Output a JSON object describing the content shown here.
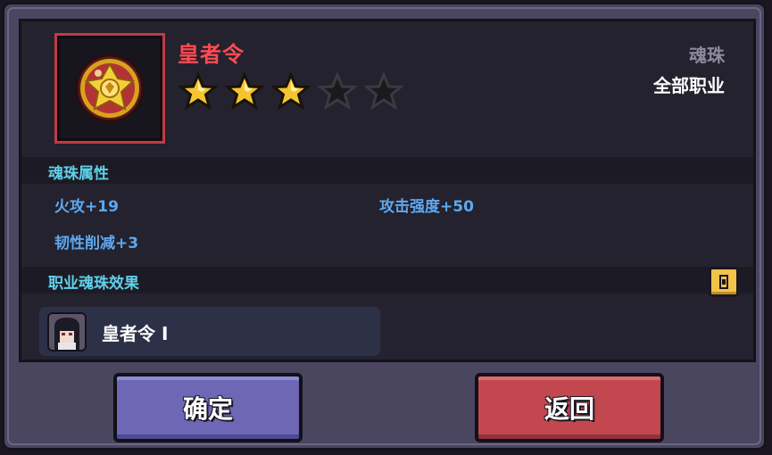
{
  "item": {
    "name": "皇者令",
    "rating": 3,
    "max_rating": 5,
    "type": "魂珠",
    "class": "全部职业"
  },
  "sections": {
    "attributes_title": "魂珠属性",
    "effects_title": "职业魂珠效果"
  },
  "stats": [
    {
      "label": "火攻+19"
    },
    {
      "label": "攻击强度+50"
    },
    {
      "label": "韧性削减+3"
    }
  ],
  "effect": {
    "name": "皇者令 Ⅰ"
  },
  "buttons": {
    "confirm": "确定",
    "back": "返回"
  },
  "colors": {
    "name_color": "#ff4a52",
    "section_title_color": "#5fd1ea",
    "stat_color": "#5fa8ef",
    "confirm_bg": "#6d67b5",
    "back_bg": "#c2474f",
    "star_filled": "#f5c530",
    "star_empty": "#1a1a1e"
  },
  "icons": {
    "item": "golden-emblem-orb-icon",
    "lock": "lock-icon",
    "avatar": "character-portrait-icon"
  }
}
